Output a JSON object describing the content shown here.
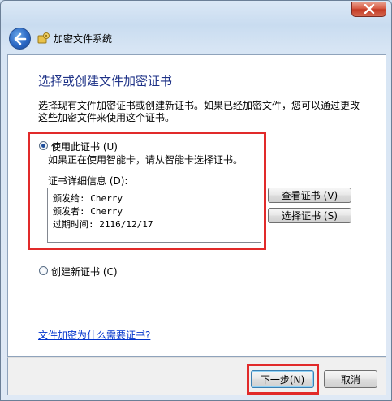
{
  "window": {
    "title": "加密文件系统"
  },
  "page": {
    "heading": "选择或创建文件加密证书",
    "description": "选择现有文件加密证书或创建新证书。如果已经加密文件，您可以通过更改这些加密文件来使用这个证书。"
  },
  "use_cert": {
    "label": "使用此证书 (U)",
    "selected": true,
    "hint": "如果正在使用智能卡，请从智能卡选择证书。",
    "details_label": "证书详细信息 (D):",
    "details": {
      "issued_to": "颁发给: Cherry",
      "issued_by": "颁发者: Cherry",
      "expires": "过期时间: 2116/12/17"
    },
    "view_button": "查看证书 (V)",
    "select_button": "选择证书 (S)"
  },
  "create_cert": {
    "label": "创建新证书 (C)",
    "selected": false
  },
  "help_link": "文件加密为什么需要证书?",
  "buttons": {
    "next": "下一步(N)",
    "cancel": "取消"
  },
  "colors": {
    "heading": "#1e3287",
    "highlight_box": "#e12a2a",
    "link": "#0033cc"
  }
}
